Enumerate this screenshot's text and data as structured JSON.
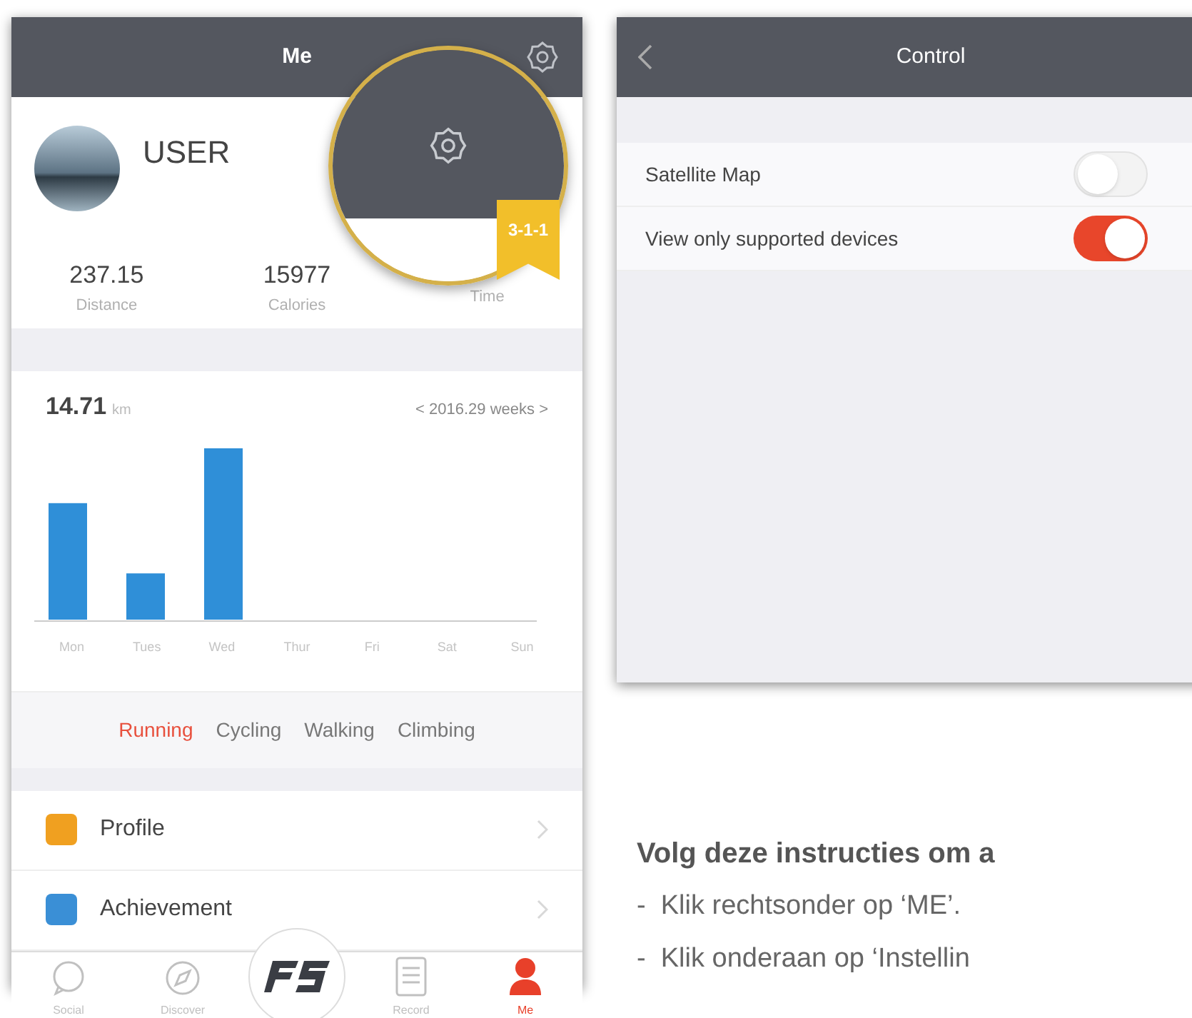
{
  "me_screen": {
    "title": "Me",
    "user": {
      "name": "USER"
    },
    "stats": [
      {
        "value": "237.15",
        "label": "Distance"
      },
      {
        "value": "15977",
        "label": "Calories"
      },
      {
        "label": "Time"
      }
    ],
    "magnifier": {
      "badge": "3-1-1"
    },
    "chart": {
      "total": "14.71",
      "unit": "km",
      "period": "< 2016.29 weeks >",
      "days": [
        "Mon",
        "Tues",
        "Wed",
        "Thur",
        "Fri",
        "Sat",
        "Sun"
      ]
    },
    "activities": [
      {
        "label": "Running",
        "selected": true
      },
      {
        "label": "Cycling",
        "selected": false
      },
      {
        "label": "Walking",
        "selected": false
      },
      {
        "label": "Climbing",
        "selected": false
      }
    ],
    "menu": [
      {
        "label": "Profile",
        "color": "#f0a020"
      },
      {
        "label": "Achievement",
        "color": "#3a8fd6"
      }
    ],
    "tab_bar": [
      {
        "label": "Social",
        "kind": "chat",
        "selected": false
      },
      {
        "label": "Discover",
        "kind": "compass",
        "selected": false
      },
      {
        "kind": "logo",
        "selected": false
      },
      {
        "label": "Record",
        "kind": "list",
        "selected": false
      },
      {
        "label": "Me",
        "kind": "person",
        "selected": true
      }
    ]
  },
  "control_screen": {
    "title": "Control",
    "settings": [
      {
        "label": "Satellite Map",
        "on": false
      },
      {
        "label": "View only supported devices",
        "on": true
      }
    ]
  },
  "instructions": {
    "heading": "Volg deze instructies om a",
    "steps": [
      "-  Klik rechtsonder op ‘ME’.",
      "-  Klik onderaan op ‘Instellin"
    ]
  }
}
